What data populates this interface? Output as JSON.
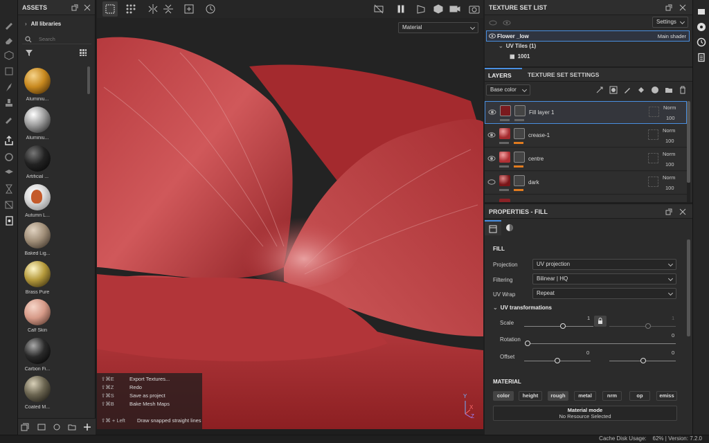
{
  "assets": {
    "title": "ASSETS",
    "library": "All libraries",
    "search_placeholder": "Search",
    "items": [
      {
        "label": "Aluminiu..."
      },
      {
        "label": "Aluminiu..."
      },
      {
        "label": "Artificial ..."
      },
      {
        "label": "Autumn L..."
      },
      {
        "label": "Baked Lig..."
      },
      {
        "label": "Brass Pure"
      },
      {
        "label": "Calf Skin"
      },
      {
        "label": "Carbon Fi..."
      },
      {
        "label": "Coated M..."
      }
    ]
  },
  "viewport": {
    "material_select": "Material",
    "shortcuts": [
      {
        "keys": "⇧⌘E",
        "action": "Export Textures..."
      },
      {
        "keys": "⇧⌘Z",
        "action": "Redo"
      },
      {
        "keys": "⇧⌘S",
        "action": "Save as project"
      },
      {
        "keys": "⇧⌘B",
        "action": "Bake Mesh Maps"
      }
    ],
    "hint_keys": "⇧⌘ + Left",
    "hint_action": "Draw snapped straight lines",
    "axis_y": "Y",
    "axis_x": "X",
    "axis_z": "Z"
  },
  "texture_set_list": {
    "title": "TEXTURE SET LIST",
    "settings": "Settings",
    "set_name": "Flower _low",
    "shader": "Main shader",
    "uv_tiles": "UV Tiles (1)",
    "tile": "1001"
  },
  "layers": {
    "tab_layers": "LAYERS",
    "tab_settings": "TEXTURE SET SETTINGS",
    "channel": "Base color",
    "rows": [
      {
        "name": "Fill layer 1",
        "blend": "Norm",
        "opacity": "100"
      },
      {
        "name": "crease-1",
        "blend": "Norm",
        "opacity": "100"
      },
      {
        "name": "centre",
        "blend": "Norm",
        "opacity": "100"
      },
      {
        "name": "dark",
        "blend": "Norm",
        "opacity": "100"
      }
    ]
  },
  "properties": {
    "title": "PROPERTIES - FILL",
    "section_fill": "FILL",
    "projection_label": "Projection",
    "projection_value": "UV projection",
    "filtering_label": "Filtering",
    "filtering_value": "Bilinear | HQ",
    "uvwrap_label": "UV Wrap",
    "uvwrap_value": "Repeat",
    "uv_transforms": "UV transformations",
    "scale_label": "Scale",
    "scale_value": "1",
    "scale_value2": "1",
    "rotation_label": "Rotation",
    "rotation_value": "0",
    "offset_label": "Offset",
    "offset_value1": "0",
    "offset_value2": "0",
    "section_material": "MATERIAL",
    "channels": [
      "color",
      "height",
      "rough",
      "metal",
      "nrm",
      "op",
      "emiss"
    ],
    "material_mode": "Material mode",
    "no_resource": "No Resource Selected"
  },
  "status": {
    "text": "Cache Disk Usage:    62% | Version: 7.2.0"
  },
  "colors": {
    "accent": "#4a90e2",
    "petal": "#b8343a",
    "orange_bar": "#e07b1f"
  }
}
